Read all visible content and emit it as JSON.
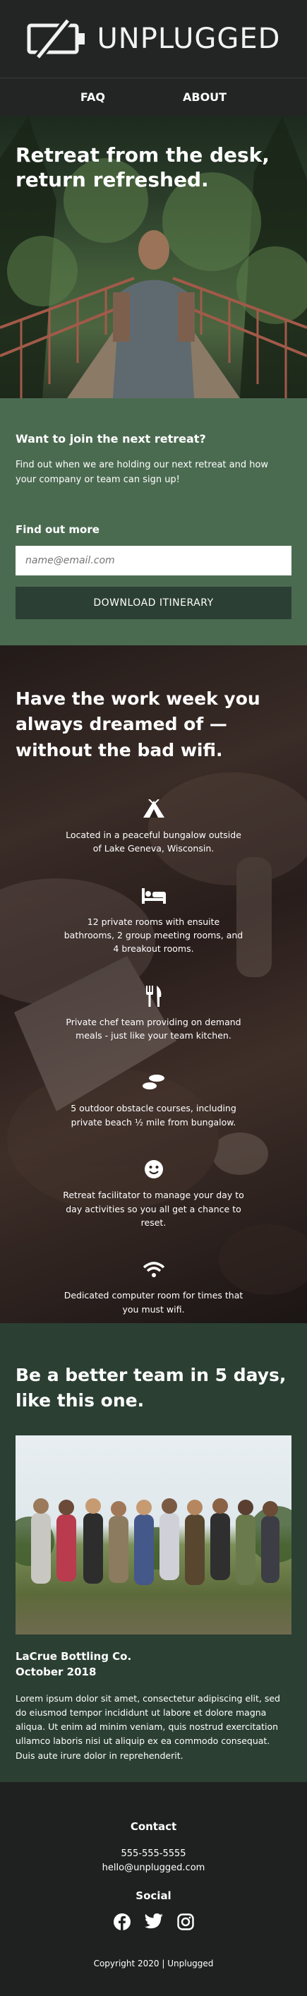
{
  "brand": {
    "name": "UNPLUGGED",
    "logo_icon": "battery-slash-icon"
  },
  "nav": {
    "items": [
      "FAQ",
      "ABOUT"
    ]
  },
  "hero": {
    "title": "Retreat from the desk, return refreshed."
  },
  "signup": {
    "heading": "Want to join the next retreat?",
    "text": "Find out when we are holding our next retreat and how your company or team can sign up!",
    "label": "Find out more",
    "email_placeholder": "name@email.com",
    "button": "DOWNLOAD ITINERARY"
  },
  "features": {
    "title": "Have the work week you always dreamed of — without the bad wifi.",
    "items": [
      {
        "icon": "campground-icon",
        "text": "Located in a peaceful bungalow outside of Lake Geneva, Wisconsin."
      },
      {
        "icon": "bed-icon",
        "text": "12 private rooms with ensuite bathrooms, 2 group meeting rooms, and 4 breakout rooms."
      },
      {
        "icon": "utensils-icon",
        "text": "Private chef team providing on demand meals - just like your team kitchen."
      },
      {
        "icon": "shoe-prints-icon",
        "text": "5 outdoor obstacle courses, including private beach ½ mile from bungalow."
      },
      {
        "icon": "smile-icon",
        "text": "Retreat facilitator to manage your day to day activities so you all get a chance to reset."
      },
      {
        "icon": "wifi-icon",
        "text": "Dedicated computer room for times that you must wifi."
      }
    ]
  },
  "team": {
    "title": "Be a better team in 5 days, like this one.",
    "company": "LaCrue Bottling Co.",
    "date": "October 2018",
    "body": "Lorem ipsum dolor sit amet, consectetur adipiscing elit, sed do eiusmod tempor incididunt ut labore et dolore magna aliqua. Ut enim ad minim veniam, quis nostrud exercitation ullamco laboris nisi ut aliquip ex ea commodo consequat. Duis aute irure dolor in reprehenderit."
  },
  "footer": {
    "contact_heading": "Contact",
    "phone": "555-555-5555",
    "email": "hello@unplugged.com",
    "social_heading": "Social",
    "social_icons": [
      "facebook-icon",
      "twitter-icon",
      "instagram-icon"
    ],
    "copyright": "Copyright 2020 | Unplugged"
  }
}
